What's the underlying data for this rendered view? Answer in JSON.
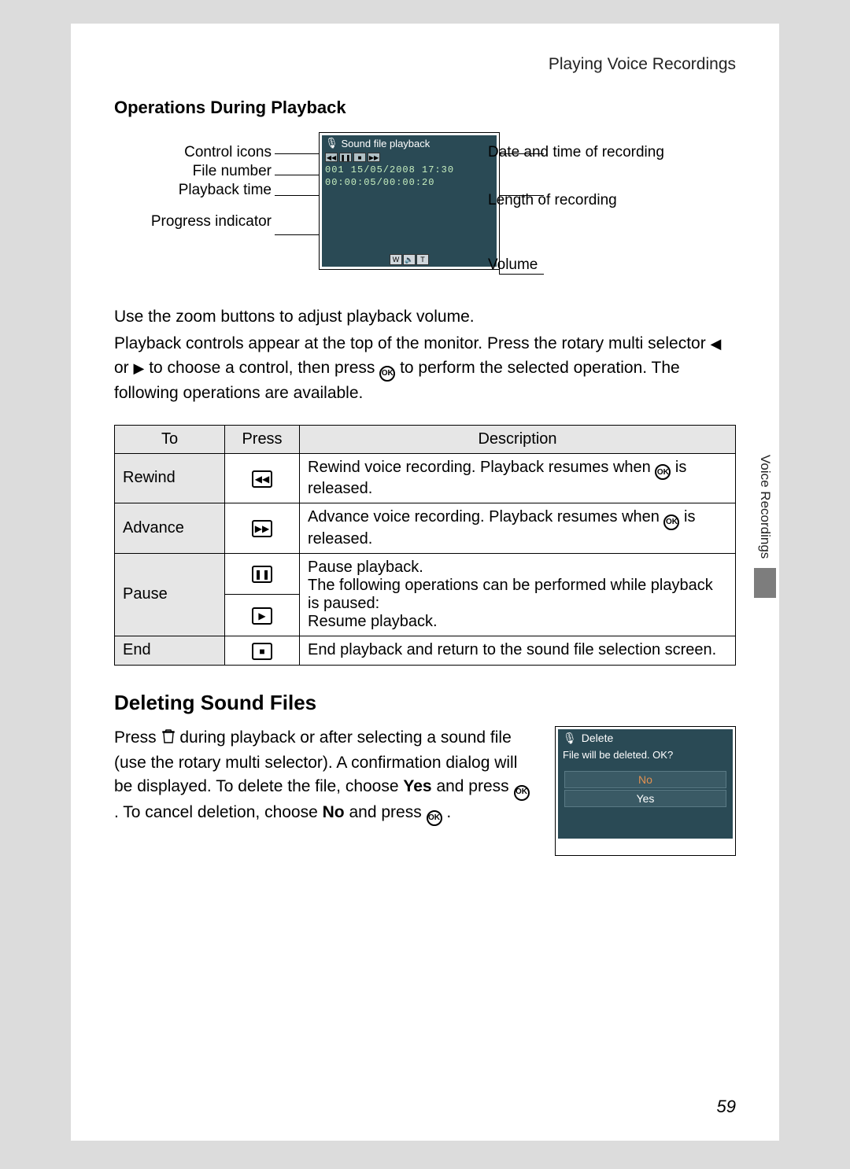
{
  "header": {
    "title": "Playing Voice Recordings"
  },
  "section1": {
    "heading": "Operations During Playback",
    "diagram_labels": {
      "left": {
        "control_icons": "Control icons",
        "file_number": "File number",
        "playback_time": "Playback time",
        "progress_indicator": "Progress indicator"
      },
      "right": {
        "date_time": "Date and time of recording",
        "length": "Length of recording",
        "volume": "Volume"
      },
      "screen": {
        "title": "Sound file playback",
        "file_line": "001 15/05/2008 17:30",
        "time_line": "00:00:05/00:00:20"
      }
    },
    "body_line1": "Use the zoom buttons to adjust playback volume.",
    "body_line2a": "Playback controls appear at the top of the monitor. Press the rotary multi selector ",
    "body_line2b": " or ",
    "body_line2c": " to choose a control, then press ",
    "body_line2d": " to perform the selected operation. The following operations are available.",
    "table": {
      "headers": {
        "to": "To",
        "press": "Press",
        "desc": "Description"
      },
      "rows": {
        "rewind": {
          "to": "Rewind",
          "desc_a": "Rewind voice recording. Playback resumes when ",
          "desc_b": " is released."
        },
        "advance": {
          "to": "Advance",
          "desc_a": "Advance voice recording. Playback resumes when ",
          "desc_b": " is released."
        },
        "pause": {
          "to": "Pause",
          "desc_line1": "Pause playback.",
          "desc_line2": "The following operations can be performed while playback is paused:",
          "desc_line3": "Resume playback."
        },
        "end": {
          "to": "End",
          "desc": "End playback and return to the sound file selection screen."
        }
      }
    }
  },
  "section2": {
    "heading": "Deleting Sound Files",
    "body_a": "Press ",
    "body_b": " during playback or after selecting a sound file (use the rotary multi selector). A confirmation dialog will be displayed. To delete the file, choose ",
    "body_yes": "Yes",
    "body_c": " and press ",
    "body_d": ". To cancel deletion, choose ",
    "body_no": "No",
    "body_e": " and press ",
    "body_f": ".",
    "screen": {
      "title": "Delete",
      "message": "File will be deleted. OK?",
      "no": "No",
      "yes": "Yes"
    }
  },
  "side_tab": "Voice Recordings",
  "page_number": "59",
  "icons": {
    "ok": "OK",
    "left": "◀",
    "right": "▶",
    "rewind": "◀◀",
    "advance": "▶▶",
    "pause": "❚❚",
    "play": "▶",
    "stop": "■",
    "mic": "🎤",
    "trash": "🗑",
    "wide": "W",
    "tele": "T",
    "speaker": "🔈"
  }
}
